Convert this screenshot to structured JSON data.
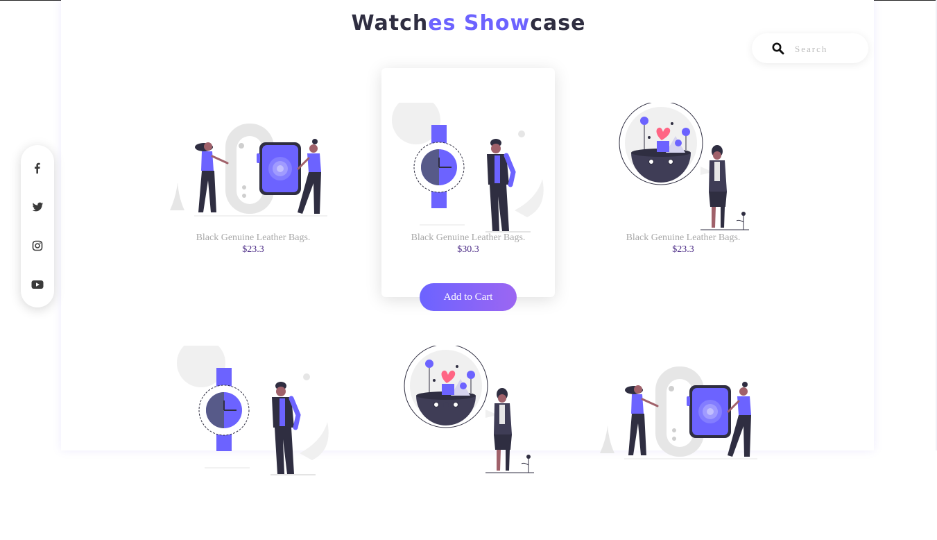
{
  "header": {
    "title_parts": [
      "Watch",
      "es Show",
      "case"
    ]
  },
  "search": {
    "placeholder": "Search"
  },
  "social": [
    {
      "name": "facebook-icon"
    },
    {
      "name": "twitter-icon"
    },
    {
      "name": "instagram-icon"
    },
    {
      "name": "youtube-icon"
    }
  ],
  "products": [
    {
      "name": "Black Genuine Leather Bags.",
      "price": "$23.3",
      "illustration": "smartwatch-two-people"
    },
    {
      "name": "Black Genuine Leather Bags.",
      "price": "$30.3",
      "illustration": "wristwatch-man"
    },
    {
      "name": "Black Genuine Leather Bags.",
      "price": "$23.3",
      "illustration": "plant-bowl-woman"
    },
    {
      "name": "",
      "price": "",
      "illustration": "wristwatch-man"
    },
    {
      "name": "",
      "price": "",
      "illustration": "plant-bowl-woman"
    },
    {
      "name": "",
      "price": "",
      "illustration": "smartwatch-two-people"
    }
  ],
  "cart": {
    "label": "Add to Cart"
  },
  "colors": {
    "accent": "#6c63ff",
    "dark": "#2f2e41",
    "skin": "#a0616a",
    "heart": "#ff6584",
    "price": "#4b2b86",
    "muted": "#a7a7a7"
  }
}
